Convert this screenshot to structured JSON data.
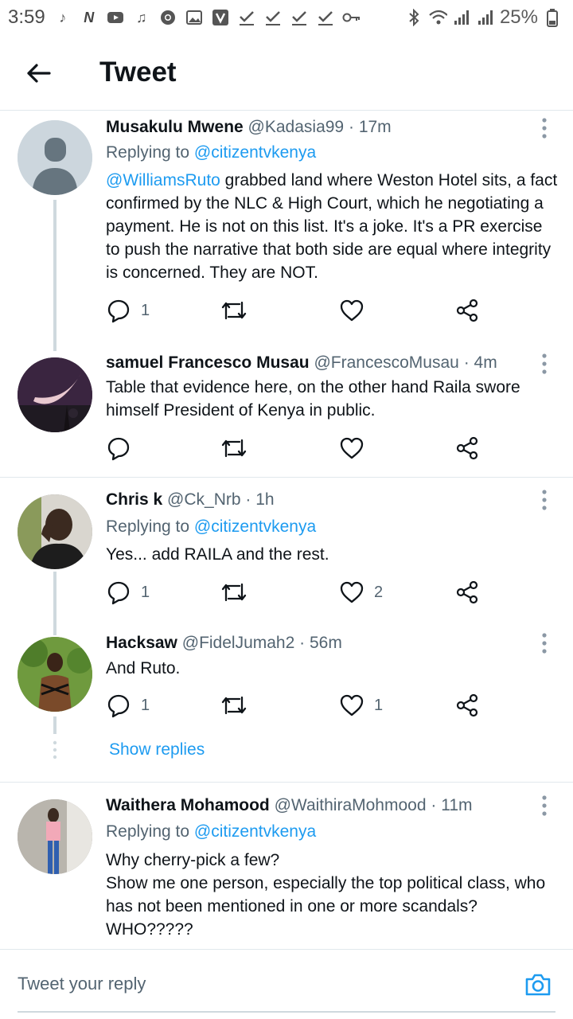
{
  "status_bar": {
    "time": "3:59",
    "battery": "25%",
    "left_icons": [
      "music-note-icon",
      "netflix-icon",
      "youtube-icon",
      "tiktok-icon",
      "chrome-icon",
      "gallery-icon",
      "v-app-icon",
      "check-icon",
      "check-icon",
      "check-icon",
      "check-icon",
      "key-icon"
    ],
    "right_icons": [
      "bluetooth-icon",
      "wifi-icon",
      "signal-icon",
      "signal-icon",
      "battery-icon"
    ]
  },
  "header": {
    "title": "Tweet"
  },
  "tweets": [
    {
      "name": "Musakulu Mwene",
      "handle": "@Kadasia99",
      "age": "17m",
      "replying_prefix": "Replying to ",
      "replying_to": "@citizentvkenya",
      "mention": "@WilliamsRuto",
      "text": " grabbed land where Weston Hotel sits, a fact confirmed by the NLC & High Court, which he negotiating a payment. He is not on this list. It's a joke. It's a PR exercise to push the narrative that both side are equal where integrity is concerned. They are NOT.",
      "replies": "1",
      "retweets": "",
      "likes": ""
    },
    {
      "name": "samuel Francesco Musau",
      "handle": "@FrancescoMusau",
      "age": "4m",
      "text": "Table that evidence here, on the other hand Raila swore himself President of Kenya in public.",
      "replies": "",
      "retweets": "",
      "likes": ""
    },
    {
      "name": "Chris k",
      "handle": "@Ck_Nrb",
      "age": "1h",
      "replying_prefix": "Replying to ",
      "replying_to": "@citizentvkenya",
      "text": "Yes... add RAILA and the rest.",
      "replies": "1",
      "retweets": "",
      "likes": "2"
    },
    {
      "name": "Hacksaw",
      "handle": "@FidelJumah2",
      "age": "56m",
      "text": "And Ruto.",
      "replies": "1",
      "retweets": "",
      "likes": "1"
    },
    {
      "name": "Waithera Mohamood",
      "handle": "@WaithiraMohmood",
      "age": "11m",
      "replying_prefix": "Replying to ",
      "replying_to": "@citizentvkenya",
      "text_lines": [
        "Why cherry-pick a few?",
        "Show me one person, especially the top political class, who has not been mentioned in one or more scandals?",
        "WHO?????"
      ]
    }
  ],
  "show_replies": "Show replies",
  "reply_bar": {
    "placeholder": "Tweet your reply"
  },
  "colors": {
    "accent": "#1d9bf0",
    "secondary_text": "#536471",
    "divider": "#e1e8ed"
  }
}
